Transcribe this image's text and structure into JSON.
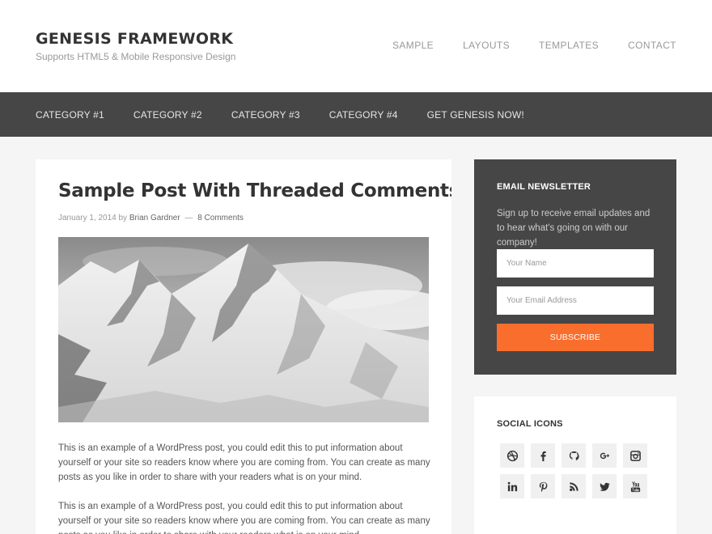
{
  "header": {
    "title": "GENESIS FRAMEWORK",
    "description": "Supports HTML5 & Mobile Responsive Design",
    "nav": [
      "SAMPLE",
      "LAYOUTS",
      "TEMPLATES",
      "CONTACT"
    ]
  },
  "secondary_nav": [
    "CATEGORY #1",
    "CATEGORY #2",
    "CATEGORY #3",
    "CATEGORY #4",
    "GET GENESIS NOW!"
  ],
  "post": {
    "title": "Sample Post With Threaded Comments",
    "date": "January 1, 2014",
    "by": "by",
    "author": "Brian Gardner",
    "separator": "—",
    "comments": "8 Comments",
    "image_icon": "mountain-photo",
    "paragraphs": [
      "This is an example of a WordPress post, you could edit this to put information about yourself or your site so readers know where you are coming from. You can create as many posts as you like in order to share with your readers what is on your mind.",
      "This is an example of a WordPress post, you could edit this to put information about yourself or your site so readers know where you are coming from. You can create as many posts as you like in order to share with your readers what is on your mind."
    ]
  },
  "newsletter": {
    "title": "EMAIL NEWSLETTER",
    "text": "Sign up to receive email updates and to hear what's going on with our company!",
    "name_placeholder": "Your Name",
    "email_placeholder": "Your Email Address",
    "button": "SUBSCRIBE"
  },
  "social": {
    "title": "SOCIAL ICONS",
    "icons": [
      "dribbble-icon",
      "facebook-icon",
      "github-icon",
      "google-plus-icon",
      "instagram-icon",
      "linkedin-icon",
      "pinterest-icon",
      "rss-icon",
      "twitter-icon",
      "youtube-icon"
    ]
  },
  "colors": {
    "accent": "#f96e2c",
    "dark": "#464646",
    "background": "#f5f5f5"
  }
}
